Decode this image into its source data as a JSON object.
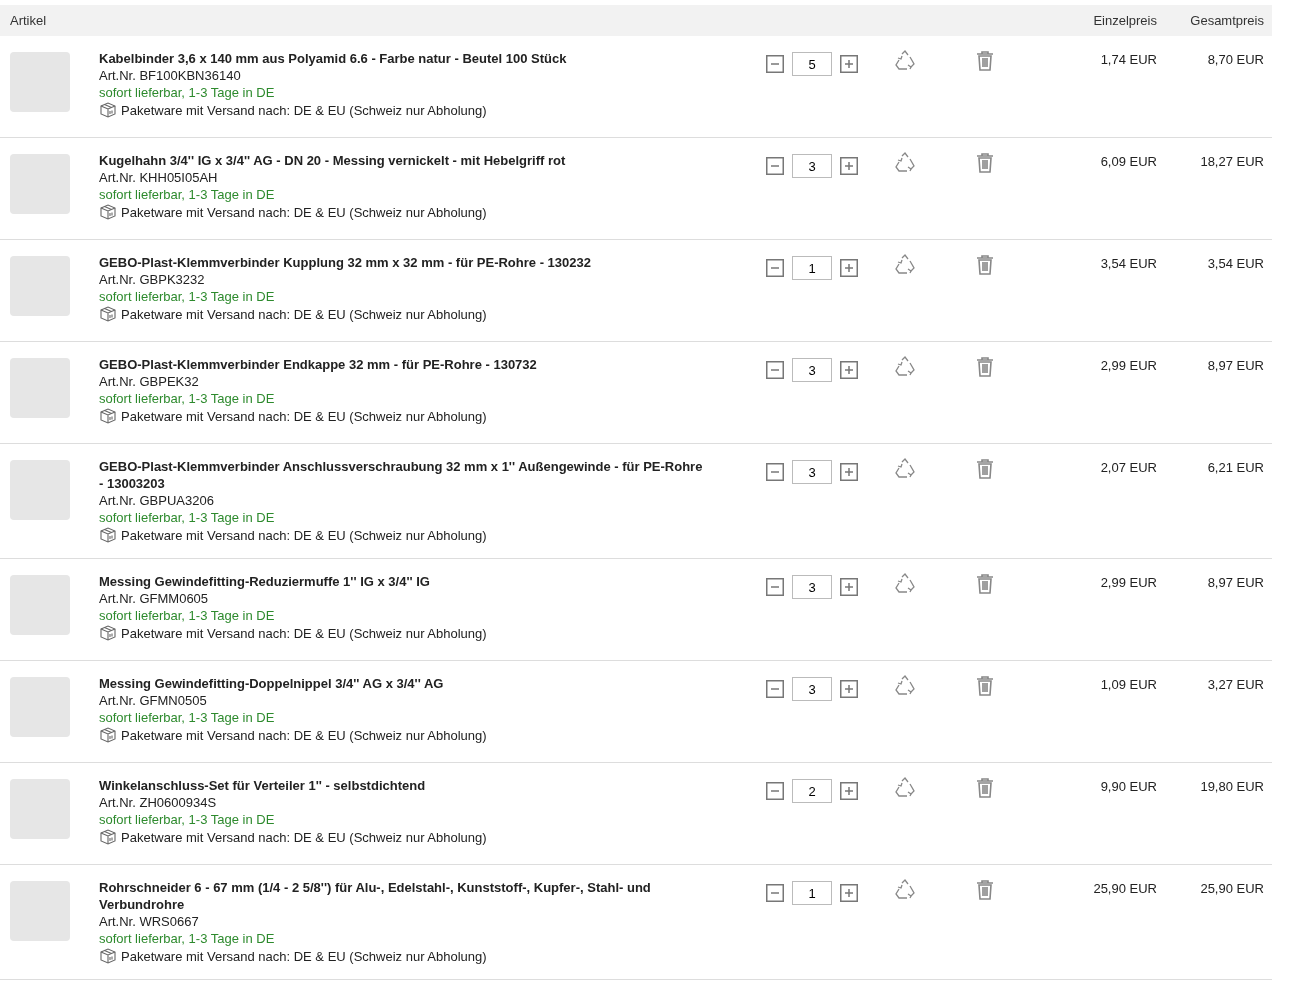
{
  "table": {
    "columns": [
      "Artikel",
      "Einzelpreis",
      "Gesamtpreis"
    ],
    "rows": [
      {
        "title": "Kabelbinder 3,6 x 140 mm aus Polyamid 6.6 - Farbe natur - Beutel 100 Stück",
        "art_nr": "Art.Nr. BF100KBN36140",
        "availability": "sofort lieferbar, 1-3 Tage in DE",
        "shipping": "Paketware mit Versand nach: DE & EU (Schweiz nur Abholung)",
        "quantity": "5",
        "unit_price": "1,74 EUR",
        "total_price": "8,70 EUR"
      },
      {
        "title": "Kugelhahn 3/4'' IG x 3/4'' AG - DN 20 - Messing vernickelt - mit Hebelgriff rot",
        "art_nr": "Art.Nr. KHH05I05AH",
        "availability": "sofort lieferbar, 1-3 Tage in DE",
        "shipping": "Paketware mit Versand nach: DE & EU (Schweiz nur Abholung)",
        "quantity": "3",
        "unit_price": "6,09 EUR",
        "total_price": "18,27 EUR"
      },
      {
        "title": "GEBO-Plast-Klemmverbinder Kupplung 32 mm x 32 mm - für PE-Rohre - 130232",
        "art_nr": "Art.Nr. GBPK3232",
        "availability": "sofort lieferbar, 1-3 Tage in DE",
        "shipping": "Paketware mit Versand nach: DE & EU (Schweiz nur Abholung)",
        "quantity": "1",
        "unit_price": "3,54 EUR",
        "total_price": "3,54 EUR"
      },
      {
        "title": "GEBO-Plast-Klemmverbinder Endkappe 32 mm - für PE-Rohre - 130732",
        "art_nr": "Art.Nr. GBPEK32",
        "availability": "sofort lieferbar, 1-3 Tage in DE",
        "shipping": "Paketware mit Versand nach: DE & EU (Schweiz nur Abholung)",
        "quantity": "3",
        "unit_price": "2,99 EUR",
        "total_price": "8,97 EUR"
      },
      {
        "title": "GEBO-Plast-Klemmverbinder Anschlussverschraubung 32 mm x 1'' Außengewinde - für PE-Rohre - 13003203",
        "art_nr": "Art.Nr. GBPUA3206",
        "availability": "sofort lieferbar, 1-3 Tage in DE",
        "shipping": "Paketware mit Versand nach: DE & EU (Schweiz nur Abholung)",
        "quantity": "3",
        "unit_price": "2,07 EUR",
        "total_price": "6,21 EUR"
      },
      {
        "title": "Messing Gewindefitting-Reduziermuffe 1'' IG x 3/4'' IG",
        "art_nr": "Art.Nr. GFMM0605",
        "availability": "sofort lieferbar, 1-3 Tage in DE",
        "shipping": "Paketware mit Versand nach: DE & EU (Schweiz nur Abholung)",
        "quantity": "3",
        "unit_price": "2,99 EUR",
        "total_price": "8,97 EUR"
      },
      {
        "title": "Messing Gewindefitting-Doppelnippel 3/4'' AG x 3/4'' AG",
        "art_nr": "Art.Nr. GFMN0505",
        "availability": "sofort lieferbar, 1-3 Tage in DE",
        "shipping": "Paketware mit Versand nach: DE & EU (Schweiz nur Abholung)",
        "quantity": "3",
        "unit_price": "1,09 EUR",
        "total_price": "3,27 EUR"
      },
      {
        "title": "Winkelanschluss-Set für Verteiler 1'' - selbstdichtend",
        "art_nr": "Art.Nr. ZH0600934S",
        "availability": "sofort lieferbar, 1-3 Tage in DE",
        "shipping": "Paketware mit Versand nach: DE & EU (Schweiz nur Abholung)",
        "quantity": "2",
        "unit_price": "9,90 EUR",
        "total_price": "19,80 EUR"
      },
      {
        "title": "Rohrschneider 6 - 67 mm (1/4 - 2 5/8'') für Alu-, Edelstahl-, Kunststoff-, Kupfer-, Stahl- und Verbundrohre",
        "art_nr": "Art.Nr. WRS0667",
        "availability": "sofort lieferbar, 1-3 Tage in DE",
        "shipping": "Paketware mit Versand nach: DE & EU (Schweiz nur Abholung)",
        "quantity": "1",
        "unit_price": "25,90 EUR",
        "total_price": "25,90 EUR"
      }
    ]
  }
}
